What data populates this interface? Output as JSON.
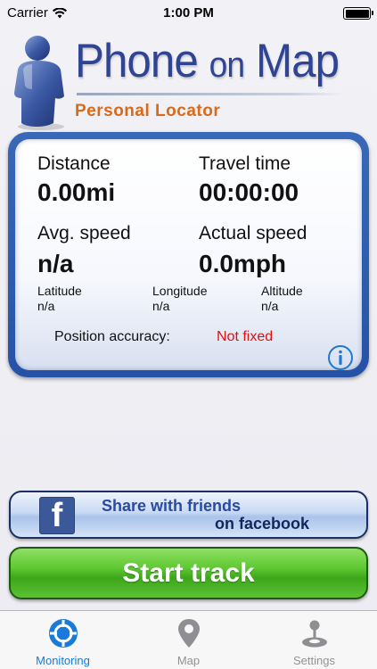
{
  "status_bar": {
    "carrier": "Carrier",
    "time": "1:00 PM"
  },
  "logo": {
    "title_main": "Phone",
    "title_connector": "on",
    "title_end": "Map",
    "subtitle": "Personal Locator"
  },
  "stats": {
    "distance_label": "Distance",
    "distance_value": "0.00mi",
    "travel_time_label": "Travel time",
    "travel_time_value": "00:00:00",
    "avg_speed_label": "Avg. speed",
    "avg_speed_value": "n/a",
    "actual_speed_label": "Actual speed",
    "actual_speed_value": "0.0mph",
    "latitude_label": "Latitude",
    "latitude_value": "n/a",
    "longitude_label": "Longitude",
    "longitude_value": "n/a",
    "altitude_label": "Altitude",
    "altitude_value": "n/a",
    "accuracy_label": "Position accuracy:",
    "accuracy_value": "Not fixed"
  },
  "share": {
    "fb_letter": "f",
    "line1": "Share with friends",
    "line2": "on facebook"
  },
  "start_button": "Start track",
  "tabs": [
    {
      "label": "Monitoring",
      "icon": "crosshair-icon",
      "active": true
    },
    {
      "label": "Map",
      "icon": "map-pin-icon",
      "active": false
    },
    {
      "label": "Settings",
      "icon": "joystick-icon",
      "active": false
    }
  ],
  "colors": {
    "brand_blue": "#2f4594",
    "subtitle_orange": "#d86a1c",
    "panel_border": "#2552a6",
    "error_red": "#e01010",
    "start_green": "#4cb526",
    "tab_active": "#1a7ad9",
    "tab_inactive": "#929292"
  }
}
